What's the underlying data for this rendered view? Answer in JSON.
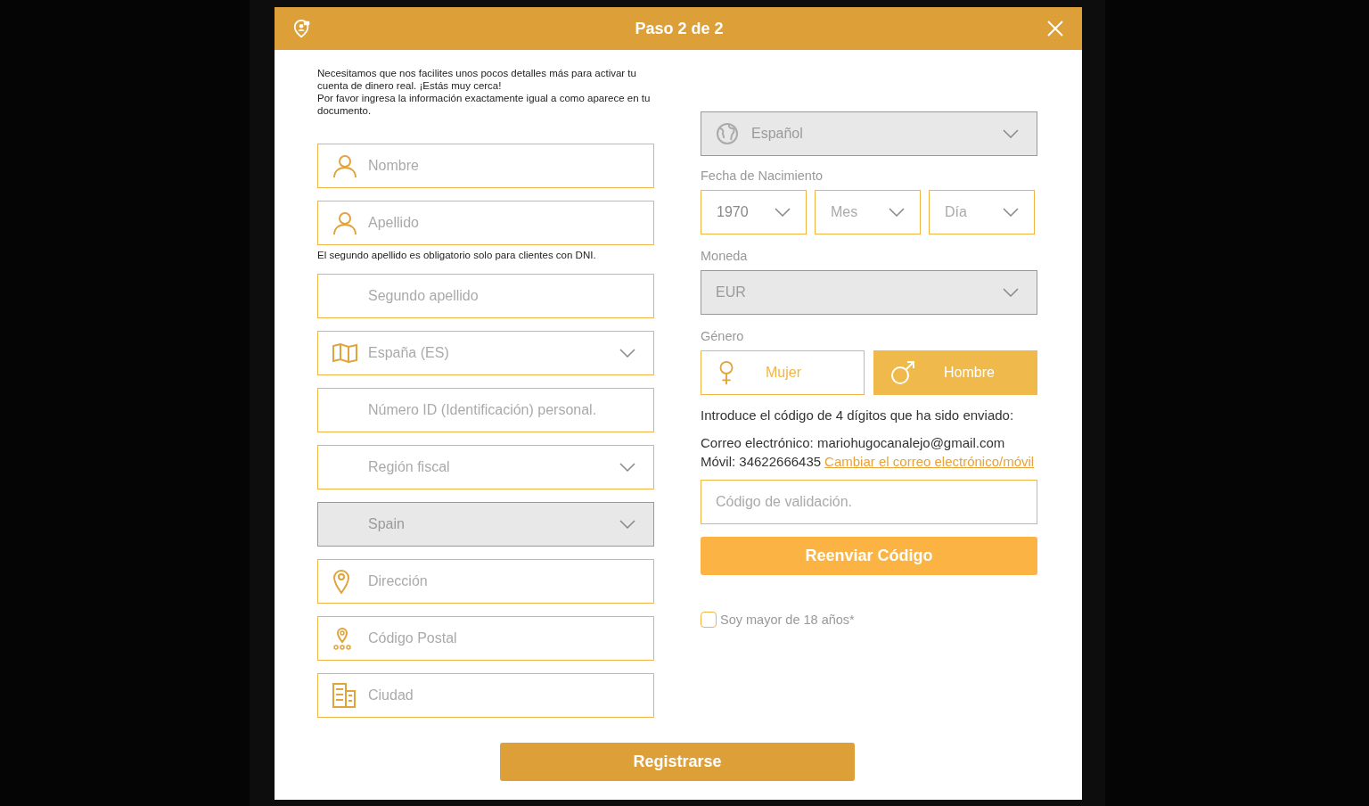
{
  "modal": {
    "title": "Paso 2 de 2"
  },
  "intro": [
    "Necesitamos que nos facilites unos pocos detalles más para activar tu cuenta de dinero real. ¡Estás muy cerca!",
    "Por favor ingresa la información exactamente igual a como aparece en tu documento."
  ],
  "left_fields": [
    {
      "kind": "input",
      "placeholder": "Nombre"
    },
    {
      "kind": "input",
      "placeholder": "Apellido",
      "note": "El segundo apellido es obligatorio solo para clientes con DNI."
    },
    {
      "kind": "input",
      "placeholder": "Segundo apellido"
    },
    {
      "kind": "select",
      "value": "España (ES)",
      "disabled": false
    },
    {
      "kind": "input",
      "placeholder": "Número ID (Identificación) personal."
    },
    {
      "kind": "select",
      "value": "Región fiscal",
      "disabled": false
    },
    {
      "kind": "select",
      "value": "Spain",
      "disabled": true
    },
    {
      "kind": "input",
      "placeholder": "Dirección"
    },
    {
      "kind": "input",
      "placeholder": "Código Postal"
    },
    {
      "kind": "input",
      "placeholder": "Ciudad"
    }
  ],
  "language": {
    "value": "Español",
    "disabled": true
  },
  "birth_date": {
    "label": "Fecha de Nacimiento",
    "selects": [
      {
        "value": "1970"
      },
      {
        "value": "Mes"
      },
      {
        "value": "Día"
      }
    ]
  },
  "currency": {
    "label": "Moneda",
    "value": "EUR",
    "disabled": true
  },
  "gender": {
    "label": "Género",
    "options": [
      {
        "label": "Mujer",
        "selected": false
      },
      {
        "label": "Hombre",
        "selected": true
      }
    ]
  },
  "verification": {
    "instruction": "Introduce el código de 4 dígitos que ha sido enviado:",
    "email": "Correo electrónico: mariohugocanalejo@gmail.com",
    "mobile": "Móvil: 34622666435",
    "change_link": "Cambiar el correo electrónico/móvil",
    "code_placeholder": "Código de validación.",
    "resend_button": "Reenviar Código"
  },
  "age_check": {
    "label": "Soy mayor de 18 años*",
    "checked": false
  },
  "submit_button": "Registrarse"
}
